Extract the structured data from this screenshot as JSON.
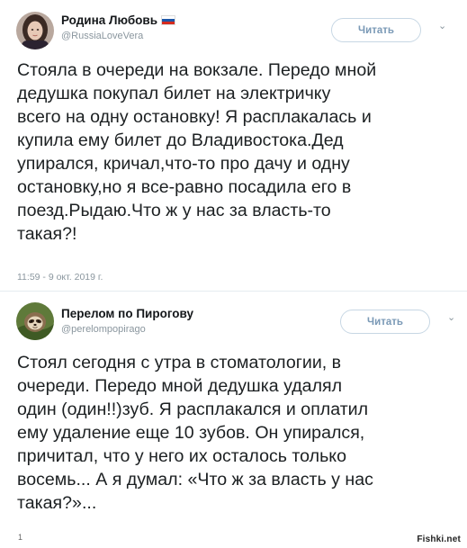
{
  "tweets": [
    {
      "display_name": "Родина Любовь",
      "handle": "@RussiaLoveVera",
      "follow_label": "Читать",
      "follow_chevron": "⌄",
      "has_flag": true,
      "text_lines": [
        "Стояла в очереди на вокзале. Передо мной",
        "дедушка покупал билет на электричку",
        "всего на одну остановку! Я расплакалась и",
        "купила ему билет до Владивостока.Дед",
        "упирался, кричал,что-то про дачу и одну",
        "остановку,но я все-равно посадила его в",
        "поезд.Рыдаю.Что ж у нас за власть-то",
        "такая?!"
      ],
      "timestamp": "11:59 - 9 окт. 2019 г."
    },
    {
      "display_name": "Перелом по Пирогову",
      "handle": "@perelompopirago",
      "follow_label": "Читать",
      "follow_chevron": "⌄",
      "has_flag": false,
      "text_lines": [
        "Стоял сегодня с утра в стоматологии, в",
        "очереди. Передо мной дедушка удалял",
        "один (один!!)зуб. Я расплакался и оплатил",
        "ему удаление еще 10 зубов. Он упирался,",
        "причитал, что у него их осталось только",
        "восемь... А я думал: «Что ж за власть у нас",
        "такая?»..."
      ]
    }
  ],
  "watermark": "Fishki.net",
  "stray_mark": "1",
  "colors": {
    "name": "#14171a",
    "text": "#1c2022",
    "muted": "#8a969e",
    "button_text": "#7a99b6",
    "button_border": "#c7d7e4",
    "divider": "#e6ecf0"
  },
  "icons": {
    "avatar_1": "woman-portrait-avatar",
    "avatar_2": "sloth-avatar",
    "flag": "russian-flag-icon",
    "chevron": "chevron-down-icon"
  }
}
